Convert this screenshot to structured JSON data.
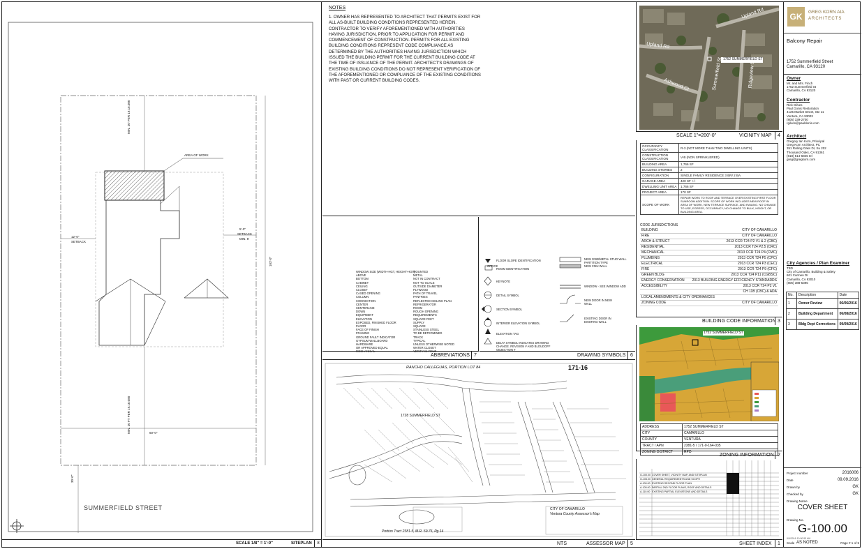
{
  "notes": {
    "title": "NOTES",
    "text": "1. OWNER HAS REPRESENTED TO ARCHITECT THAT PERMITS EXIST FOR ALL AS-BUILT BUILDING CONDITIONS REPRESENTED HEREIN. CONTRACTOR TO VERIFY AFOREMENTIONED WITH AUTHORITIES HAVING JURISDICTION, PRIOR TO APPLICATION FOR PERMIT AND COMMENCEMENT OF CONSTRUCTION. PERMITS FOR ALL EXISTING BUILDING CONDITIONS REPRESENT CODE COMPLIANCE AS DETERMINED BY THE AUTHORITIES HAVING JURISDICTION WHICH ISSUED THE BUILDING PERMIT FOR THE CURRENT BUILDING CODE AT THE TIME OF ISSUANCE OF THE PERMIT. ARCHITECT'S DRAWINGS OF EXISTING BUILDING CONDITIONS DO NOT REPRESENT VERIFICATION OF THE AFOREMENTIONED OR COMPLIANCE OF THE EXISTING CONDITIONS WITH PAST OR CURRENT BUILDING CODES."
  },
  "site_plan": {
    "street": "SUMMERFIELD STREET",
    "area_of_work": "AREA OF WORK",
    "setback_left": "12'-0\"",
    "setback_left_label": "SETBACK",
    "setback_right": "5'-0\"",
    "setback_right_label": "SETBACK",
    "setback_right_min": "MIN. 5'",
    "rear_yard": "MIN. 20' PER 19.16.080",
    "front_yard": "MIN. 20 FT PER 19.16.080",
    "depth": "103'-0\"",
    "width": "60'-0\"",
    "front": "30'-0\"",
    "scale": "SCALE 1/8\" = 1'-0\"",
    "title": "SITEPLAN",
    "num": "8"
  },
  "vicinity": {
    "scale": "SCALE 1\"=200'-0\"",
    "title": "VICINITY MAP",
    "num": "4",
    "marker": "1752 SUMMERFIELD ST",
    "roads": [
      "Upland Rd",
      "Upland Rd",
      "Summerfield St",
      "Ashwood Ct",
      "Ridgeview St"
    ]
  },
  "building_info": {
    "title": "BUILDING CODE INFORMATION",
    "num": "3",
    "rows": [
      [
        "OCCUPANCY CLASSIFICATION",
        "R-3 (NOT MORE THAN TWO DWELLING UNITS)"
      ],
      [
        "CONSTRUCTION CLASSIFICATION",
        "V-B (NON SPRINKLERED)"
      ],
      [
        "BUILDING AREA",
        "1,766 SF"
      ],
      [
        "BUILDING STORIES",
        "2"
      ],
      [
        "CONFIGURATION",
        "SINGLE FAMILY RESIDENCE 3 BR/ 2 BA"
      ],
      [
        "GARAGE AREA",
        "420 SF +/-"
      ],
      [
        "DWELLING UNIT AREA",
        "1,766 SF"
      ],
      [
        "PROJECT AREA",
        "170 SF"
      ],
      [
        "SCOPE OF WORK",
        "REPAIR WORK TO ROOF AND TERRACE OVER EXISTING FIRST FLOOR SUNROOM ADDITION. SCOPE OF WORK INCLUDES NEW ROOF IN AREA OF WORK, NEW TERRACE SURFACE, AND RAILING. NO CHANGE TO USE, EGRESS, OCCUPANCY, NO CHANGE TO BULK, HEIGHT, OR BUILDING AREA."
      ]
    ],
    "jurisdictions_title": "CODE JURISDICTIONS",
    "jurisdictions": [
      [
        "BUILDING",
        "CITY OF CAMARILLO"
      ],
      [
        "FIRE",
        "CITY OF CAMARILLO"
      ],
      [
        "ARCH & STRUCT",
        "2013 CCR T24 P2 V1 & 2 (CBC)"
      ],
      [
        "RESIDENTIAL",
        "2013 CCR T24 P2.5 (CRC)"
      ],
      [
        "MECHANICAL",
        "2013 CCR T24 P4 (CMC)"
      ],
      [
        "PLUMBING",
        "2013 CCR T24 P5 (CPC)"
      ],
      [
        "ELECTRICAL",
        "2013 CCR T24 P3 (CEC)"
      ],
      [
        "FIRE",
        "2013 CCR T24 P9 (CFC)"
      ],
      [
        "GREEN BLDG",
        "2013 CCR T24 P11 (CGBSC)"
      ],
      [
        "ENERGY CONSERVATION",
        "2013 BUILDING ENERGY EFFICIENCY STANDARDS"
      ],
      [
        "ACCESSIBILITY",
        "2013 CCR T24 P2 V1"
      ],
      [
        "",
        "CH 11B (CBC) & ADA"
      ],
      [
        "LOCAL AMENDMENTS & CITY ORDINANCES",
        ""
      ],
      [
        "ZONING CODE",
        "CITY OF CAMARILLO"
      ]
    ]
  },
  "abbreviations": {
    "title": "ABBREVIATIONS",
    "num": "7",
    "col1": [
      "WINDOW SIZE (WIDTH-HGT, HEIGHT-HGT)",
      "ABOVE",
      "BOTTOM",
      "CABINET",
      "CEILING",
      "CLOSET",
      "CASED OPENING",
      "COLUMN",
      "CONNECTION",
      "CENTER",
      "CENTERLINE",
      "DOWN",
      "EQUIPMENT",
      "ELEVATION",
      "EXPOSED, FINISHED FLOOR",
      "FLOOR",
      "FACE OF FINISH",
      "FRAMING",
      "GROUND FAULT INDICATOR",
      "GYPSUM WALLBOARD",
      "HARDWARE",
      "OR APPROVED EQUAL",
      "MECHANICAL"
    ],
    "col2": [
      "MOUNTED",
      "METAL",
      "NOT IN CONTRACT",
      "NOT TO SCALE",
      "OUTSIDE DIAMETER",
      "PLYWOOD",
      "PATH OF TRAVEL",
      "PANTRIES",
      "REFLECTED CEILING PLAN",
      "REFRIGERATOR",
      "ROOM",
      "ROUGH OPENING",
      "REQUIREMENTS",
      "SQUARE FEET",
      "SUPPLY",
      "SQUARE",
      "STAINLESS STEEL",
      "TO BE DETERMINED",
      "TRACK",
      "TYPICAL",
      "UNLESS OTHERWISE NOTED",
      "WATER CLOSET",
      "VERIFY IN FIELD"
    ]
  },
  "drawing_symbols": {
    "title": "DRAWING SYMBOLS",
    "num": "6",
    "items": [
      "FLOOR SLOPE IDENTIFICATION",
      "ROOM IDENTIFICATION",
      "KEYNOTE",
      "DETAIL SYMBOL",
      "SECTION SYMBOL",
      "INTERIOR ELEVATION SYMBOL",
      "ELEVATION TAG",
      "DELTA SYMBOL INDICATES DRAWING CHANGE. REVISION # AND BLOUDOFF OBJECTION #"
    ],
    "right_items": [
      "NEW GWB/METAL STUD WALL PARTITION TYPE",
      "NEW CMU WALL",
      "WINDOW - SEE WINDOW ADD",
      "NEW DOOR IN NEW WALL",
      "EXISTING DOOR IN EXISTING WALL"
    ],
    "office": "OFFICE"
  },
  "assessor": {
    "title": "ASSESSOR MAP",
    "nts": "NTS",
    "num": "5",
    "header": "RANCHO CALLEGUAS, PORTION LOT 84",
    "book": "171-16",
    "marker": "1728 SUMMERFIELD ST",
    "city": "CITY OF CAMARILLO",
    "county": "Ventura County Assessor's Map",
    "tract": "Portion Tract 2381-5, M.R. 59.75, Pg.14"
  },
  "zoning": {
    "title": "ZONING INFORMATION",
    "num": "2",
    "marker": "1752 SUMMERFIELD ST",
    "rows": [
      [
        "ADDRESS",
        "1752 SUMMERFIELD ST"
      ],
      [
        "CITY",
        "CAMARILLO"
      ],
      [
        "COUNTY",
        "VENTURA"
      ],
      [
        "TRACT / APN",
        "2381-5 / 171-0-164-035"
      ],
      [
        "ZONING DISTRICT",
        "RPD"
      ]
    ]
  },
  "sheet_index": {
    "title": "SHEET INDEX",
    "num": "1",
    "rows": [
      [
        "G-100.00",
        "COVER SHEET, VICINITY MAP, AND SITEPLAN"
      ],
      [
        "G-105.00",
        "GENERAL REQUIREMENTS AND SCOPE"
      ],
      [
        "A-100.00",
        "EXISTING SECOND FLOOR PLAN"
      ],
      [
        "A-105.00",
        "PARTIAL 2ND FLOOR PLANS, ROOF AND DETAILS"
      ],
      [
        "A-110.00",
        "EXISTING PARTIAL ELEVATIONS AND DETAILS"
      ]
    ]
  },
  "title_block": {
    "firm_logo": "GK",
    "firm_name": "GREG KORN AIA",
    "firm_sub": "ARCHITECTS",
    "project": "Balcony Repair",
    "address1": "1752 Summerfield Street",
    "address2": "Camarillo, CA 93120",
    "owner_h": "Owner",
    "owner": [
      "Mr. and Mrs. Finch",
      "1752 Summerfield St",
      "Camarillo, CA 93120"
    ],
    "contractor_h": "Contractor",
    "contractor": [
      "Rick Gilves",
      "Paul Donis Restoration",
      "4125 Market Street, Ste 11",
      "Ventura, CA 93003",
      "(805) 339-2700",
      "rgilves@pauldonis.com"
    ],
    "architect_h": "Architect",
    "architect": [
      "Gregory Ian Korn, Principal",
      "Greg Korn Architect, PC",
      "351 Rolling Oaks Dr, Su 202",
      "Thousand Oaks, CA 91361",
      "(818) 514-6845 tel",
      "greg@gregkorn.com"
    ],
    "agency_h": "City Agencies / Plan Examiner",
    "agency": [
      "TBD",
      "City of Camarillo, Building & Safety",
      "601 Carmen Dr",
      "Camarillo, CA 93010",
      "(805) 388-5395"
    ],
    "rev_headers": [
      "No.",
      "Description",
      "Date"
    ],
    "revisions": [
      [
        "1",
        "Owner Review",
        "06/06/2016"
      ],
      [
        "2",
        "Building Department",
        "06/08/2016"
      ],
      [
        "3",
        "Bldg Dept Corrections",
        "09/09/2016"
      ]
    ],
    "project_number_label": "Project number",
    "project_number": "2016006",
    "date_label": "Date",
    "date": "09.09.2016",
    "drawn_label": "Drawn by",
    "drawn": "GK",
    "checked_label": "Checked by",
    "checked": "GK",
    "drawing_name_label": "Drawing Name",
    "drawing_name": "COVER SHEET",
    "drawing_no_label": "Drawing No.",
    "drawing_no": "G-100.00",
    "scale_label": "Scale",
    "scale": "AS NOTED",
    "page": "Page # 1 of 5",
    "date_stamp": "9/9/2016 10:00:53 AM"
  }
}
